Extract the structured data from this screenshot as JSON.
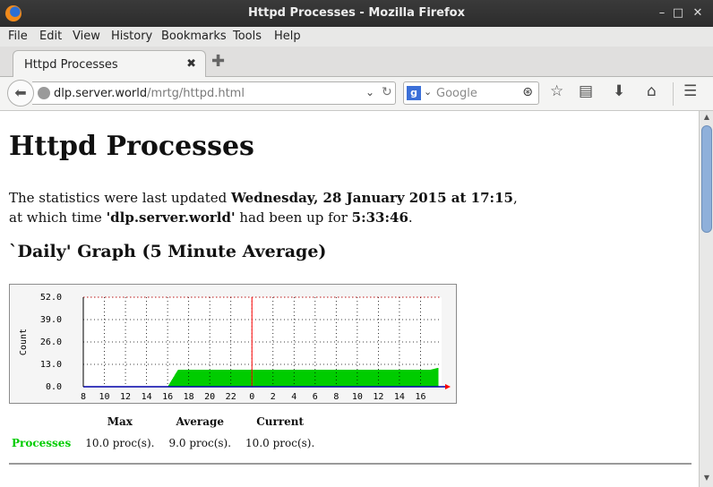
{
  "window": {
    "title": "Httpd Processes - Mozilla Firefox",
    "minimize": "–",
    "maximize": "□",
    "close": "✕"
  },
  "menu": [
    "File",
    "Edit",
    "View",
    "History",
    "Bookmarks",
    "Tools",
    "Help"
  ],
  "tab": {
    "label": "Httpd Processes",
    "close": "✖",
    "new": "✚"
  },
  "nav": {
    "url_host": "dlp.server.world",
    "url_path": "/mrtg/httpd.html",
    "url_prefix": "",
    "search_placeholder": "Google"
  },
  "page": {
    "heading": "Httpd Processes",
    "line1_pre": "The statistics were last updated ",
    "line1_bold": "Wednesday, 28 January 2015 at 17:15",
    "line1_post": ",",
    "line2_pre": "at which time ",
    "line2_bold1": "'dlp.server.world'",
    "line2_mid": " had been up for ",
    "line2_bold2": "5:33:46",
    "line2_post": ".",
    "graph_heading": "`Daily' Graph (5 Minute Average)"
  },
  "chart_data": {
    "type": "area",
    "ylabel": "Count",
    "yticks": [
      "52.0",
      "39.0",
      "26.0",
      "13.0",
      "0.0"
    ],
    "ylim": [
      0,
      52
    ],
    "xticks": [
      "8",
      "10",
      "12",
      "14",
      "16",
      "18",
      "20",
      "22",
      "0",
      "2",
      "4",
      "6",
      "8",
      "10",
      "12",
      "14",
      "16"
    ],
    "x_hours": [
      8,
      9,
      10,
      11,
      12,
      13,
      14,
      15,
      16,
      17,
      18,
      19,
      20,
      21,
      22,
      23,
      24,
      25,
      26,
      27,
      28,
      29,
      30,
      31,
      32,
      33,
      34,
      35,
      36,
      37,
      38,
      39,
      40,
      41,
      41.7
    ],
    "values": [
      0,
      0,
      0,
      0,
      0,
      0,
      0,
      0,
      0,
      10,
      10,
      10,
      10,
      10,
      10,
      10,
      10,
      10,
      10,
      10,
      10,
      10,
      10,
      10,
      10,
      10,
      10,
      10,
      10,
      10,
      10,
      10,
      10,
      10,
      11
    ],
    "series": [
      {
        "name": "Processes",
        "color": "#00cc00"
      }
    ],
    "grid": true,
    "colors": {
      "fill": "#00cc00",
      "now_line": "#ff0000",
      "grid": "#000000"
    }
  },
  "stats": {
    "headers": [
      "Max",
      "Average",
      "Current"
    ],
    "rows": [
      {
        "label": "Processes",
        "max": "10.0 proc(s).",
        "average": "9.0 proc(s).",
        "current": "10.0 proc(s)."
      }
    ]
  }
}
